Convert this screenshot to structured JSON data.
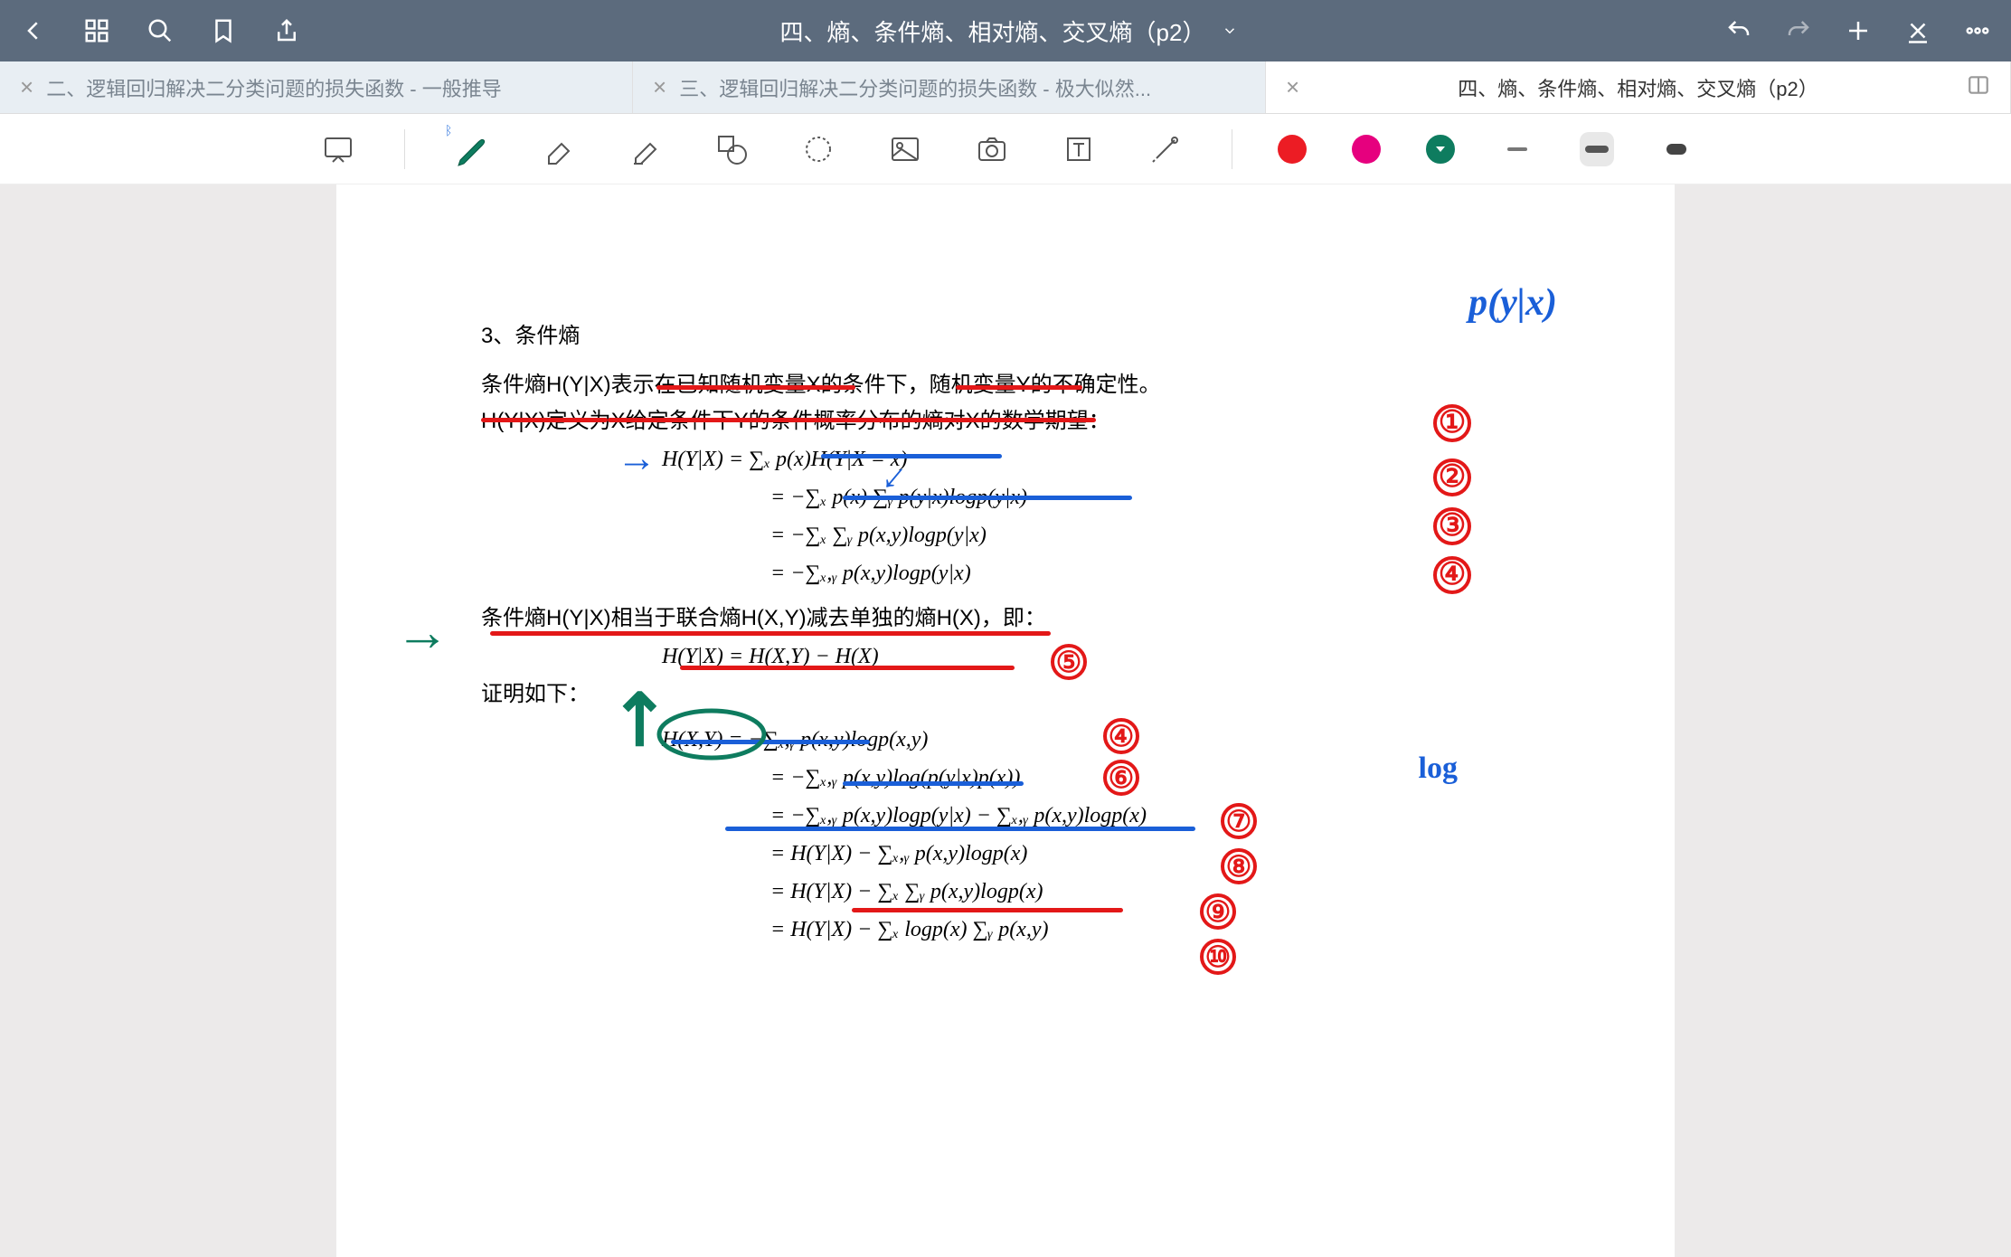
{
  "header": {
    "title": "四、熵、条件熵、相对熵、交叉熵（p2）"
  },
  "tabs": [
    {
      "label": "二、逻辑回归解决二分类问题的损失函数 - 一般推导",
      "active": false
    },
    {
      "label": "三、逻辑回归解决二分类问题的损失函数 - 极大似然...",
      "active": false
    },
    {
      "label": "四、熵、条件熵、相对熵、交叉熵（p2）",
      "active": true
    }
  ],
  "toolbar": {
    "tools": [
      "presentation",
      "pen",
      "eraser",
      "highlighter",
      "shape",
      "lasso",
      "image",
      "camera",
      "text",
      "laser"
    ],
    "colors": {
      "red": "#ec1c24",
      "pink": "#e6007e",
      "teal": "#0e7c5f"
    },
    "strokes": [
      "thin",
      "medium",
      "thick"
    ],
    "selected_stroke": "medium"
  },
  "document": {
    "section_number": "3、条件熵",
    "line1": "条件熵H(Y|X)表示在已知随机变量X的条件下，随机变量Y的不确定性。",
    "line2": "H(Y|X)定义为X给定条件下Y的条件概率分布的熵对X的数学期望：",
    "eq1": "H(Y|X) = ∑ₓ p(x)H(Y|X = x)",
    "eq2": "= −∑ₓ p(x) ∑ᵧ p(y|x)logp(y|x)",
    "eq3": "= −∑ₓ ∑ᵧ p(x,y)logp(y|x)",
    "eq4": "= −∑ₓ,ᵧ p(x,y)logp(y|x)",
    "line3": "条件熵H(Y|X)相当于联合熵H(X,Y)减去单独的熵H(X)，即：",
    "eq5": "H(Y|X) = H(X,Y) − H(X)",
    "line4": "证明如下：",
    "eq6": "H(X,Y) = −∑ₓ,ᵧ p(x,y)logp(x,y)",
    "eq7": "= −∑ₓ,ᵧ p(x,y)log(p(y|x)p(x))",
    "eq8": "= −∑ₓ,ᵧ p(x,y)logp(y|x) − ∑ₓ,ᵧ p(x,y)logp(x)",
    "eq9": "= H(Y|X) − ∑ₓ,ᵧ p(x,y)logp(x)",
    "eq10": "= H(Y|X) − ∑ₓ ∑ᵧ p(x,y)logp(x)",
    "eq11": "= H(Y|X) − ∑ₓ logp(x) ∑ᵧ p(x,y)"
  },
  "annotations": {
    "top_note": "p(y|x)",
    "log_note": "log",
    "right_numbers": [
      "①",
      "②",
      "③",
      "④"
    ],
    "step_numbers": [
      "⑤",
      "④",
      "⑥",
      "⑦",
      "⑧",
      "⑨",
      "⑩"
    ]
  }
}
